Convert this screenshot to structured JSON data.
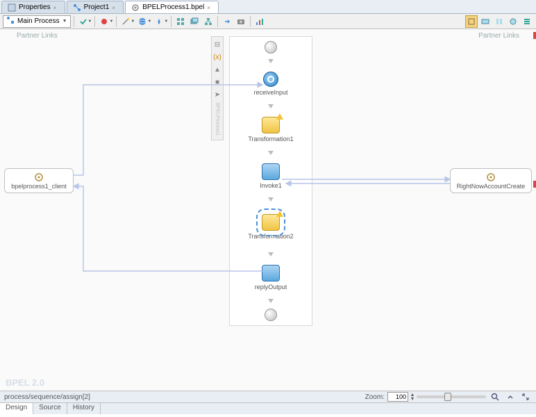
{
  "tabs": [
    {
      "label": "Properties",
      "icon": "prefs-icon"
    },
    {
      "label": "Project1",
      "icon": "workflow-icon"
    },
    {
      "label": "BPELProcess1.bpel",
      "icon": "gear-icon",
      "active": true
    }
  ],
  "toolbar": {
    "process_dropdown": "Main Process",
    "right_buttons": [
      "view1-icon",
      "view2-icon",
      "view3-icon",
      "view4-icon",
      "chart-icon"
    ]
  },
  "partner_labels": {
    "left": "Partner Links",
    "right": "Partner Links"
  },
  "partner_links": {
    "left": {
      "name": "bpelprocess1_client"
    },
    "right": {
      "name": "RightNowAccountCreate"
    }
  },
  "process_nodes": [
    {
      "type": "start"
    },
    {
      "type": "receive",
      "label": "receiveInput"
    },
    {
      "type": "transform",
      "label": "Transformation1",
      "warning": true
    },
    {
      "type": "invoke",
      "label": "Invoke1"
    },
    {
      "type": "transform",
      "label": "Transformation2",
      "warning": true,
      "selected": true
    },
    {
      "type": "reply",
      "label": "replyOutput"
    },
    {
      "type": "end"
    }
  ],
  "watermark": "BPEL 2.0",
  "breadcrumb": "process/sequence/assign[2]",
  "zoom": {
    "label": "Zoom:",
    "value": "100"
  },
  "bottom_tabs": [
    "Design",
    "Source",
    "History"
  ]
}
